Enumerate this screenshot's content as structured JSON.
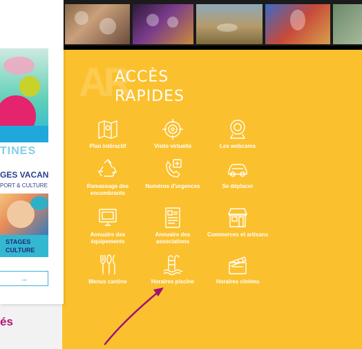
{
  "left": {
    "promo2_title": "TINES",
    "promo2_subtitle": "GES VACANCES",
    "promo2_tagline": "PORT & CULTURE",
    "promo2_banner_line1": "STAGES",
    "promo2_banner_line2": "CULTURE",
    "arrow_label": "→",
    "bottom_text": "és"
  },
  "quick_access": {
    "watermark": "AR",
    "title_line1": "ACCÈS",
    "title_line2": "RAPIDES",
    "items": [
      {
        "label": "Plan intéractif",
        "icon": "map-icon"
      },
      {
        "label": "Visite virtuelle",
        "icon": "target-icon"
      },
      {
        "label": "Les webcams",
        "icon": "webcam-icon"
      },
      {
        "label": "Ramassage des encombrants",
        "icon": "recycle-icon"
      },
      {
        "label": "Numéros d'urgences",
        "icon": "emergency-phone-icon"
      },
      {
        "label": "Se déplacer",
        "icon": "car-icon"
      },
      {
        "label": "Annuaire des équipements",
        "icon": "monitor-icon"
      },
      {
        "label": "Annuaire des associations",
        "icon": "directory-icon"
      },
      {
        "label": "Commerces et artisans",
        "icon": "shop-icon"
      },
      {
        "label": "Menus cantine",
        "icon": "cutlery-icon"
      },
      {
        "label": "Horaires piscine",
        "icon": "pool-icon"
      },
      {
        "label": "Horaires cinéma",
        "icon": "clapperboard-icon"
      }
    ]
  },
  "colors": {
    "panel": "#fbc02d",
    "annotation_arrow": "#a01278",
    "bottom_text": "#b2157a"
  }
}
